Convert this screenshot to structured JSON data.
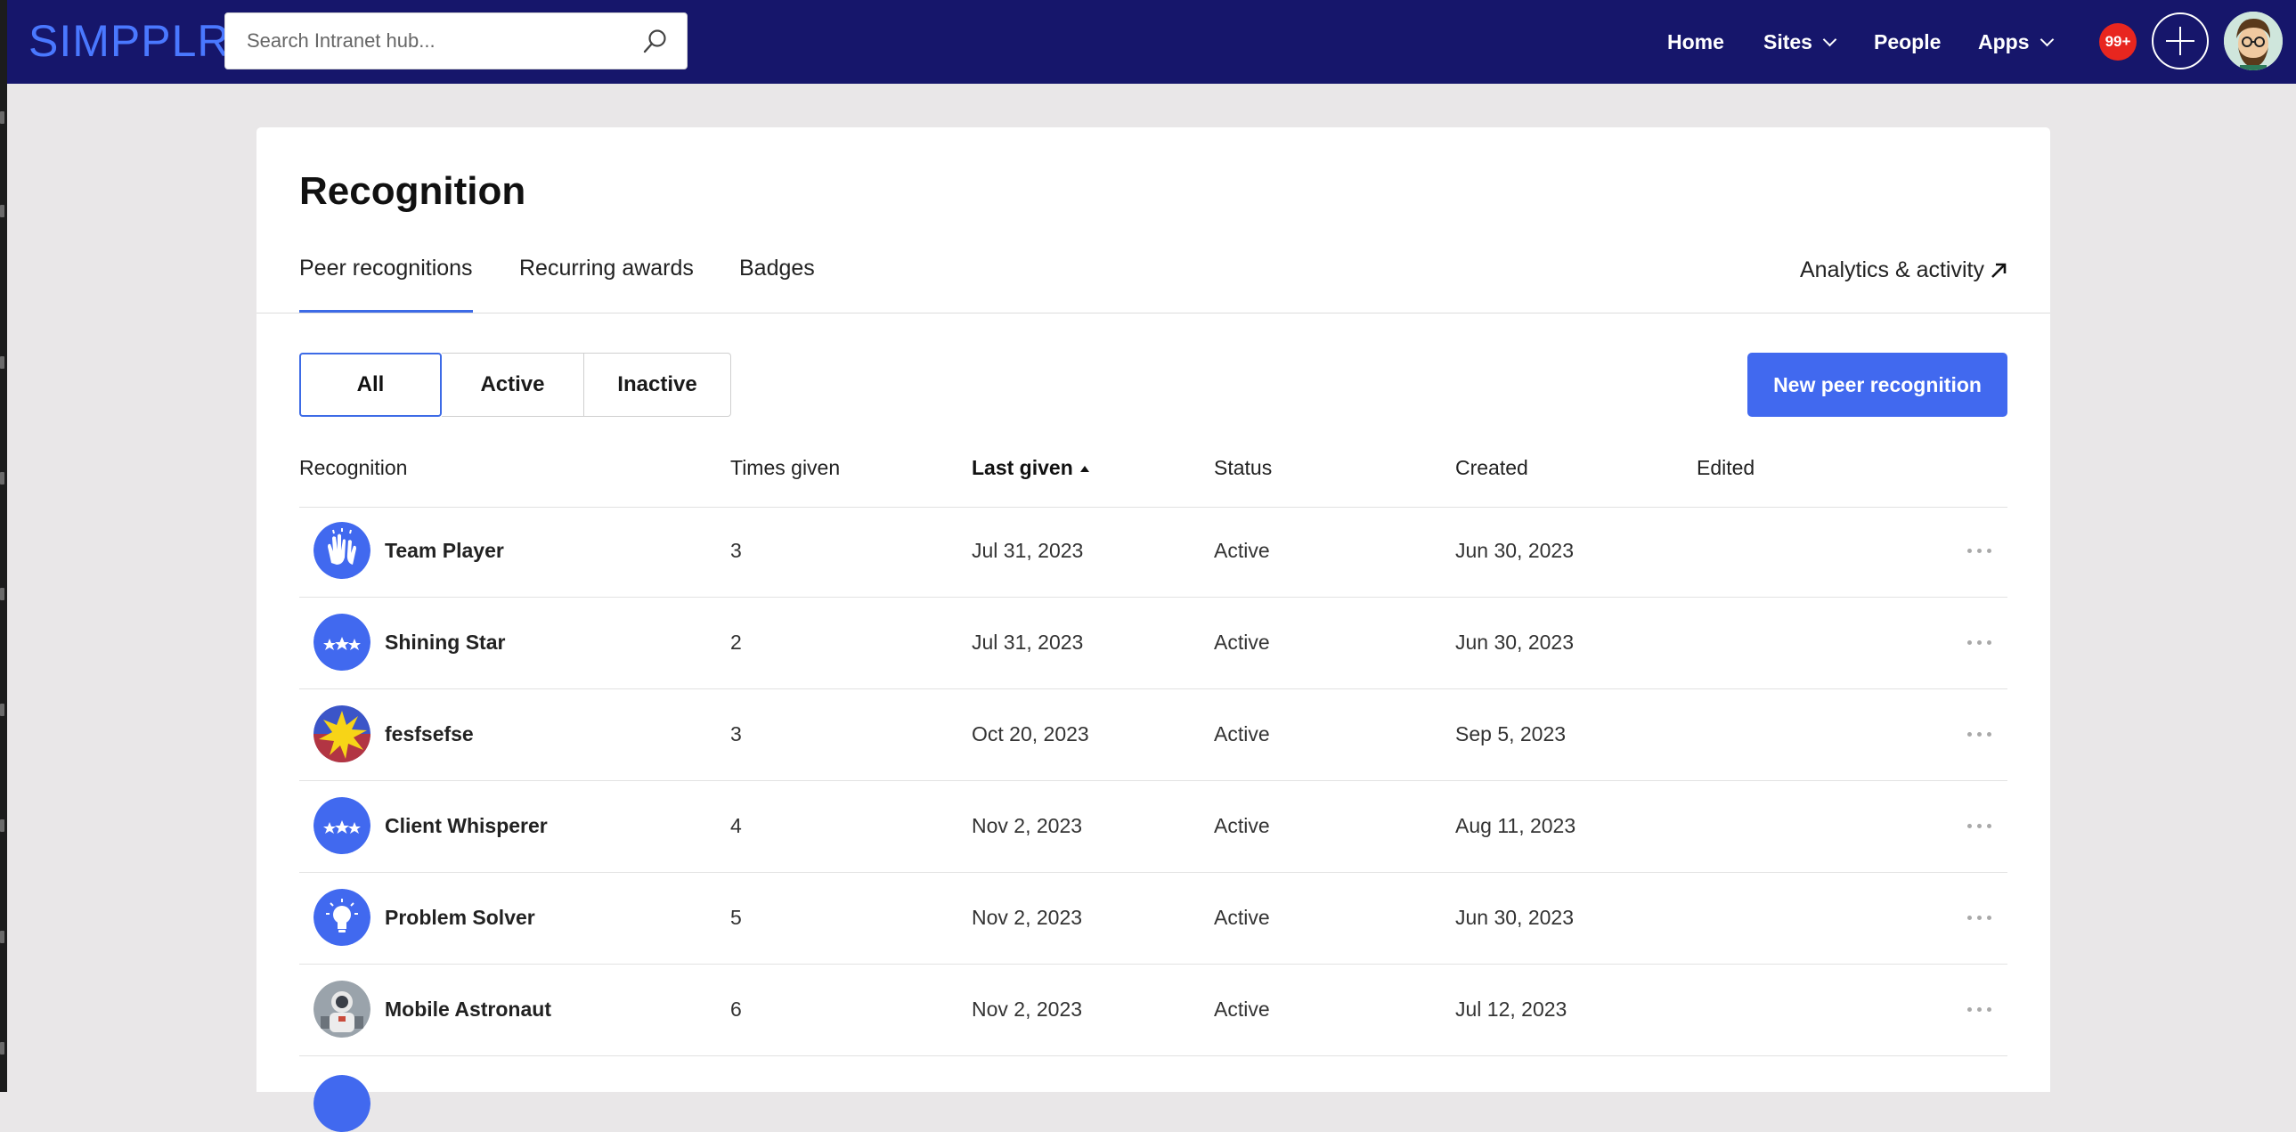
{
  "header": {
    "logo_text": "SIMPPLR",
    "search_placeholder": "Search Intranet hub...",
    "nav": {
      "home": "Home",
      "sites": "Sites",
      "people": "People",
      "apps": "Apps"
    },
    "notification_count": "99+",
    "colors": {
      "bar": "#16166b",
      "logo": "#4a78ff",
      "notification": "#e8261f"
    }
  },
  "page": {
    "title": "Recognition",
    "tabs": [
      "Peer recognitions",
      "Recurring awards",
      "Badges"
    ],
    "active_tab": "Peer recognitions",
    "analytics_link": "Analytics & activity",
    "filters": [
      "All",
      "Active",
      "Inactive"
    ],
    "active_filter": "All",
    "new_button": "New peer recognition",
    "accent_color": "#4169ef"
  },
  "table": {
    "columns": {
      "recognition": "Recognition",
      "times_given": "Times given",
      "last_given": "Last given",
      "status": "Status",
      "created": "Created",
      "edited": "Edited"
    },
    "sorted_by": "Last given",
    "sort_direction": "ascending",
    "rows": [
      {
        "icon": "clapping-hands-icon",
        "name": "Team Player",
        "times_given": "3",
        "last_given": "Jul 31, 2023",
        "status": "Active",
        "created": "Jun 30, 2023",
        "edited": ""
      },
      {
        "icon": "stars-icon",
        "name": "Shining Star",
        "times_given": "2",
        "last_given": "Jul 31, 2023",
        "status": "Active",
        "created": "Jun 30, 2023",
        "edited": ""
      },
      {
        "icon": "starburst-icon",
        "name": "fesfsefse",
        "times_given": "3",
        "last_given": "Oct 20, 2023",
        "status": "Active",
        "created": "Sep 5, 2023",
        "edited": ""
      },
      {
        "icon": "stars-icon",
        "name": "Client Whisperer",
        "times_given": "4",
        "last_given": "Nov 2, 2023",
        "status": "Active",
        "created": "Aug 11, 2023",
        "edited": ""
      },
      {
        "icon": "lightbulb-icon",
        "name": "Problem Solver",
        "times_given": "5",
        "last_given": "Nov 2, 2023",
        "status": "Active",
        "created": "Jun 30, 2023",
        "edited": ""
      },
      {
        "icon": "astronaut-photo-icon",
        "name": "Mobile Astronaut",
        "times_given": "6",
        "last_given": "Nov 2, 2023",
        "status": "Active",
        "created": "Jul 12, 2023",
        "edited": ""
      }
    ]
  }
}
